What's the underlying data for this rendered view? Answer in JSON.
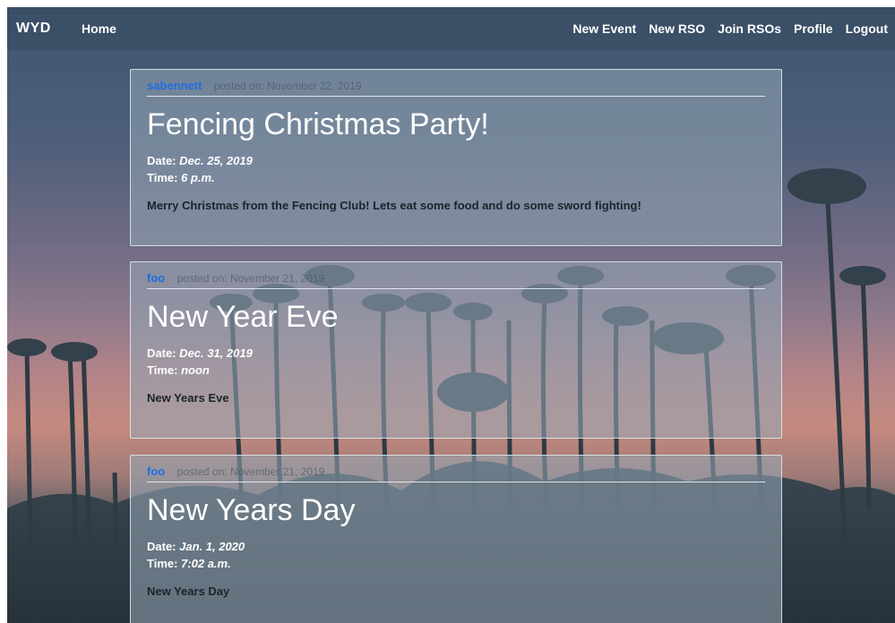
{
  "nav": {
    "brand": "WYD",
    "home": "Home",
    "links": [
      "New Event",
      "New RSO",
      "Join RSOs",
      "Profile",
      "Logout"
    ]
  },
  "posts": [
    {
      "author": "sabennett",
      "posted": "posted on: November 22, 2019",
      "title": "Fencing Christmas Party!",
      "date_label": "Date:",
      "date": "Dec. 25, 2019",
      "time_label": "Time:",
      "time": "6 p.m.",
      "description": "Merry Christmas from the Fencing Club! Lets eat some food and do some sword fighting!"
    },
    {
      "author": "foo",
      "posted": "posted on: November 21, 2019",
      "title": "New Year Eve",
      "date_label": "Date:",
      "date": "Dec. 31, 2019",
      "time_label": "Time:",
      "time": "noon",
      "description": "New Years Eve"
    },
    {
      "author": "foo",
      "posted": "posted on: November 21, 2019",
      "title": "New Years Day",
      "date_label": "Date:",
      "date": "Jan. 1, 2020",
      "time_label": "Time:",
      "time": "7:02 a.m.",
      "description": "New Years Day"
    }
  ],
  "colors": {
    "author": "#1e6fe0",
    "card_bg": "rgba(150,168,182,0.55)"
  }
}
